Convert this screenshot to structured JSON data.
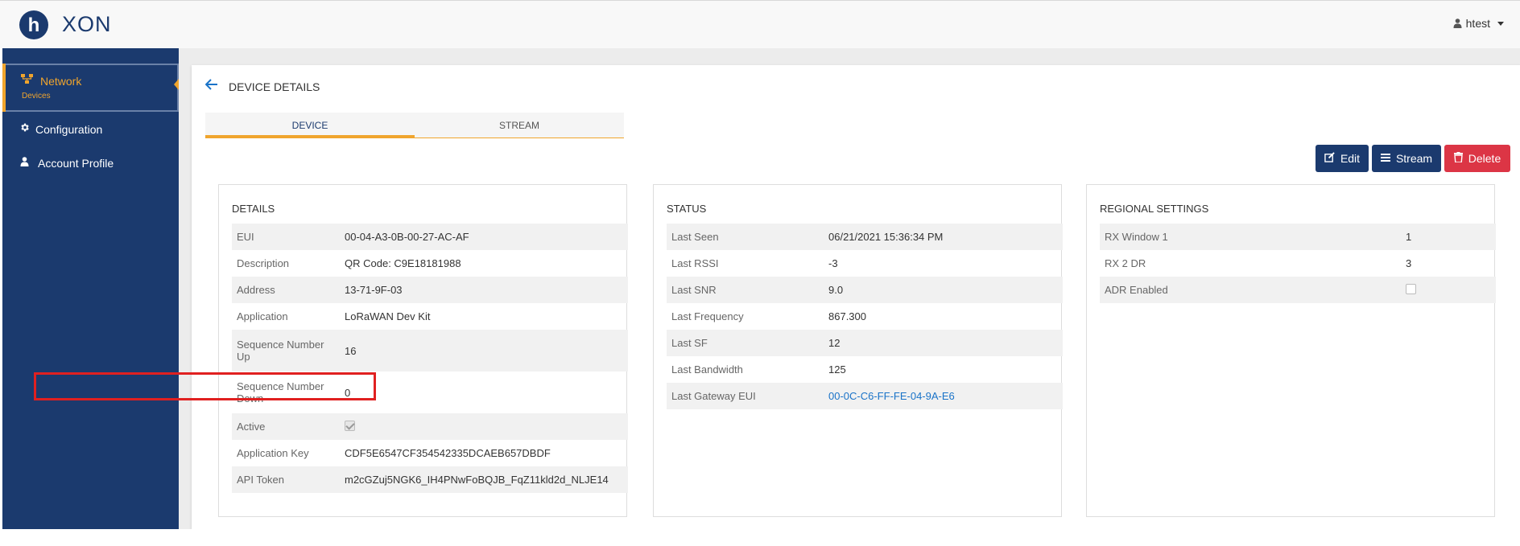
{
  "header": {
    "brand": "XON",
    "logo_letter": "h",
    "user": "htest",
    "user_icon": "user-icon"
  },
  "sidebar": {
    "items": [
      {
        "label": "Network",
        "sublabel": "Devices",
        "icon": "network-icon",
        "active": true
      },
      {
        "label": "Configuration",
        "icon": "gear-icon"
      },
      {
        "label": "Account Profile",
        "icon": "user-icon"
      }
    ],
    "accent_color": "#f0a52d",
    "bg_color": "#1b3a6e"
  },
  "page": {
    "title": "DEVICE DETAILS",
    "tabs": [
      {
        "label": "DEVICE",
        "active": true
      },
      {
        "label": "STREAM",
        "active": false
      }
    ]
  },
  "actions": {
    "edit": "Edit",
    "stream": "Stream",
    "delete": "Delete",
    "primary_color": "#1b3a6e",
    "danger_color": "#dc3545"
  },
  "details": {
    "title": "DETAILS",
    "rows": [
      {
        "key": "EUI",
        "value": "00-04-A3-0B-00-27-AC-AF"
      },
      {
        "key": "Description",
        "value": "QR Code: C9E18181988"
      },
      {
        "key": "Address",
        "value": "13-71-9F-03"
      },
      {
        "key": "Application",
        "value": "LoRaWAN Dev Kit"
      },
      {
        "key": "Sequence Number Up",
        "value": "16"
      },
      {
        "key": "Sequence Number Down",
        "value": "0"
      },
      {
        "key": "Active",
        "value": "",
        "checked": true
      },
      {
        "key": "Application Key",
        "value": "CDF5E6547CF354542335DCAEB657DBDF"
      },
      {
        "key": "API Token",
        "value": "m2cGZuj5NGK6_IH4PNwFoBQJB_FqZ11kld2d_NLJE14"
      }
    ]
  },
  "status": {
    "title": "STATUS",
    "rows": [
      {
        "key": "Last Seen",
        "value": "06/21/2021 15:36:34 PM"
      },
      {
        "key": "Last RSSI",
        "value": "-3"
      },
      {
        "key": "Last SNR",
        "value": "9.0"
      },
      {
        "key": "Last Frequency",
        "value": "867.300"
      },
      {
        "key": "Last SF",
        "value": "12"
      },
      {
        "key": "Last Bandwidth",
        "value": "125"
      },
      {
        "key": "Last Gateway EUI",
        "value": "00-0C-C6-FF-FE-04-9A-E6",
        "link": true
      }
    ]
  },
  "regional": {
    "title": "REGIONAL SETTINGS",
    "rows": [
      {
        "key": "RX Window 1",
        "value": "1"
      },
      {
        "key": "RX 2 DR",
        "value": "3"
      },
      {
        "key": "ADR Enabled",
        "value": "",
        "checked": false
      }
    ]
  }
}
